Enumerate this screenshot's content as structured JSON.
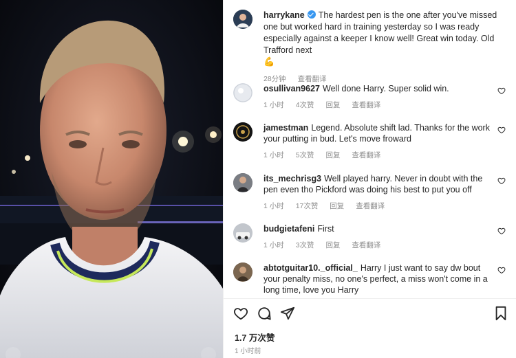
{
  "post": {
    "username": "harrykane",
    "caption": "The hardest pen is the one after you've missed one but worked hard in training yesterday so I was ready especially against a keeper I know well! Great win today. Old Trafford next",
    "emoji": "💪",
    "time": "28分钟",
    "translate": "查看翻译"
  },
  "comments": [
    {
      "username": "osullivan9627",
      "text": "Well done Harry. Super solid win.",
      "time": "1 小时",
      "likes": "4次赞",
      "reply": "回复",
      "translate": "查看翻译"
    },
    {
      "username": "jamestman",
      "text": "Legend. Absolute shift lad. Thanks for the work your putting in bud. Let's move froward",
      "time": "1 小时",
      "likes": "5次赞",
      "reply": "回复",
      "translate": "查看翻译"
    },
    {
      "username": "its_mechrisg3",
      "text": "Well played harry. Never in doubt with the pen even tho Pickford was doing his best to put you off",
      "time": "1 小时",
      "likes": "17次赞",
      "reply": "回复",
      "translate": "查看翻译"
    },
    {
      "username": "budgietafeni",
      "text": "First",
      "time": "1 小时",
      "likes": "3次赞",
      "reply": "回复",
      "translate": "查看翻译"
    },
    {
      "username": "abtotguitar10._official_",
      "text": "Harry I just want to say dw bout your penalty miss, no one's perfect, a miss won't come in a long time, love you Harry"
    }
  ],
  "footer": {
    "likes": "1.7 万次赞",
    "posted": "1 小时前"
  },
  "icons": {
    "like": "heart-icon",
    "comment": "comment-icon",
    "share": "share-icon",
    "save": "bookmark-icon"
  },
  "colors": {
    "verified": "#3897f0",
    "meta_text": "#8e8e8e",
    "text": "#262626"
  }
}
